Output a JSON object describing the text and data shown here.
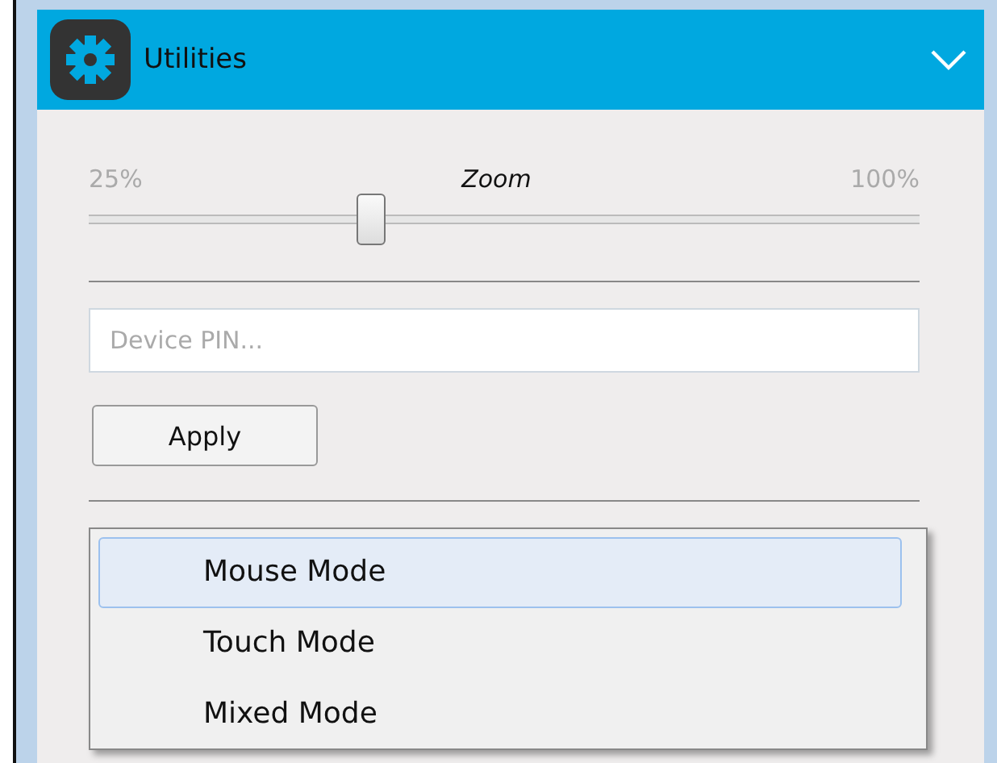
{
  "panel": {
    "title": "Utilities",
    "expanded": true
  },
  "zoom": {
    "min_label": "25%",
    "label": "Zoom",
    "max_label": "100%",
    "level": 0.34
  },
  "pin": {
    "placeholder": "Device PIN..."
  },
  "apply_button": "Apply",
  "menu": [
    {
      "label": "Mouse Mode",
      "selected": true
    },
    {
      "label": "Touch Mode",
      "selected": false
    },
    {
      "label": "Mixed Mode",
      "selected": false
    }
  ]
}
